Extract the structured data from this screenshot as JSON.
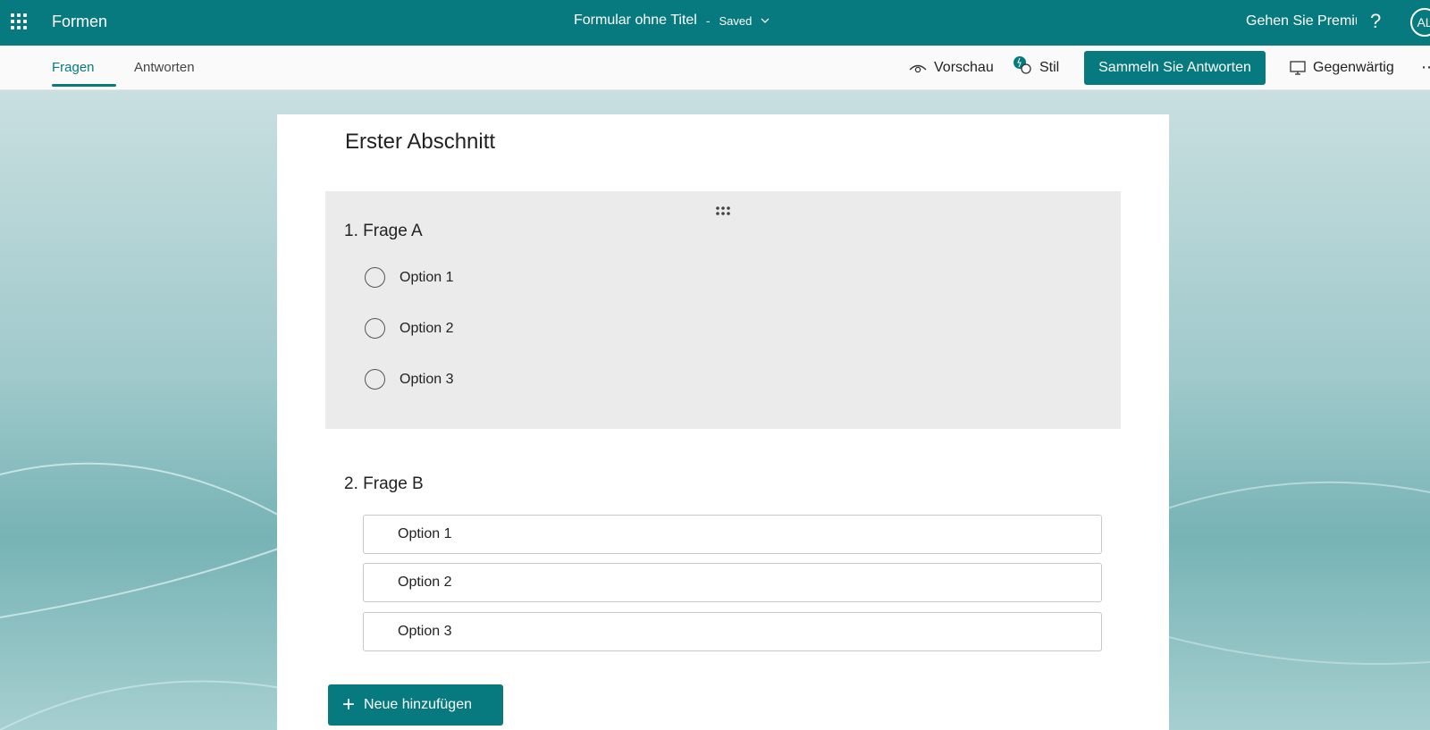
{
  "topbar": {
    "app_name": "Formen",
    "form_title": "Formular ohne Titel",
    "separator": "-",
    "saved_status": "Saved",
    "premium_label": "Gehen Sie Premium",
    "help_glyph": "?",
    "avatar_initials": "AL"
  },
  "tabs": [
    {
      "label": "Fragen",
      "active": true
    },
    {
      "label": "Antworten",
      "active": false
    }
  ],
  "toolbar": {
    "preview_label": "Vorschau",
    "style_label": "Stil",
    "collect_label": "Sammeln Sie Antworten",
    "present_label": "Gegenwärtig"
  },
  "form": {
    "section_title": "Erster Abschnitt",
    "questions": [
      {
        "number": "1.",
        "title": "Frage A",
        "type": "choice",
        "options": [
          "Option 1",
          "Option 2",
          "Option 3"
        ]
      },
      {
        "number": "2.",
        "title": "Frage B",
        "type": "ranking",
        "options": [
          "Option 1",
          "Option 2",
          "Option 3"
        ]
      }
    ],
    "add_new_label": "Neue hinzufügen"
  },
  "colors": {
    "brand": "#077a80",
    "active_question_bg": "#ebebeb"
  },
  "icons": [
    "waffle-icon",
    "chevron-down-icon",
    "diamond-icon",
    "help-icon",
    "eye-icon",
    "palette-icon",
    "monitor-icon",
    "drag-handle-icon",
    "plus-icon",
    "more-icon"
  ]
}
